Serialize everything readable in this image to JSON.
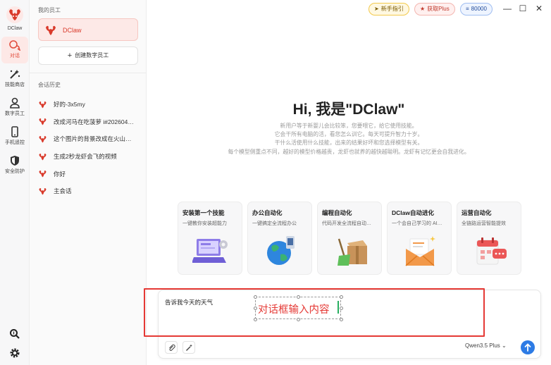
{
  "app": {
    "name": "DClaw"
  },
  "rail": {
    "logo_label": "DClaw",
    "items": [
      {
        "label": "对话",
        "icon": "chat-icon",
        "active": true
      },
      {
        "label": "技能商店",
        "icon": "magic-wand-icon",
        "active": false
      },
      {
        "label": "数字员工",
        "icon": "person-icon",
        "active": false
      },
      {
        "label": "手机遥控",
        "icon": "phone-icon",
        "active": false
      },
      {
        "label": "安全防护",
        "icon": "shield-icon",
        "active": false
      }
    ],
    "bottom": [
      {
        "icon": "search-icon"
      },
      {
        "icon": "gear-icon"
      }
    ]
  },
  "sidebar": {
    "employees_title": "我的员工",
    "employee_name": "DClaw",
    "create_label": "创建数字员工",
    "history_title": "会话历史",
    "history": [
      "好的-3x5my",
      "改成河马在吃菠萝 i#202604…",
      "这个图片的背景改成在火山…",
      "生成2秒龙虾会飞的视频",
      "你好",
      "主会话"
    ]
  },
  "topbar": {
    "guide": "新手指引",
    "plus": "获取Plus",
    "coins": "80000",
    "window_controls": [
      "minimize",
      "maximize",
      "close"
    ]
  },
  "hero": {
    "title": "Hi, 我是\"DClaw\"",
    "lines": [
      "新用户等于新婴儿会比较笨，您要喂它，给它使用技能。",
      "它会干所有电脑的活，看您怎么训它。每天可提升智力十岁。",
      "干什么活使用什么技能，出来的结果好坏和您选择模型有关。",
      "每个模型侧重点不同，越好的模型价格越贵，龙虾也就养的越快越聪明。龙虾有记忆更会自我进化。"
    ]
  },
  "cards": [
    {
      "title": "安装第一个技能",
      "desc": "一键教你安装超能力",
      "icon": "laptop-install-icon"
    },
    {
      "title": "办公自动化",
      "desc": "一键搞定全流程办公",
      "icon": "globe-office-icon"
    },
    {
      "title": "编程自动化",
      "desc": "代码开发全流程自动…",
      "icon": "box-broom-icon"
    },
    {
      "title": "DClaw自动进化",
      "desc": "一个会自己学习的 AI…",
      "icon": "envelope-icon"
    },
    {
      "title": "运营自动化",
      "desc": "全链路运营智能提效",
      "icon": "calendar-icon"
    }
  ],
  "composer": {
    "text": "告诉我今天的天气",
    "annotation": "对话框输入内容",
    "model": "Qwen3.5 Plus"
  },
  "colors": {
    "accent": "#e14b3b",
    "highlight": "#e53935",
    "send": "#2d7be5"
  }
}
